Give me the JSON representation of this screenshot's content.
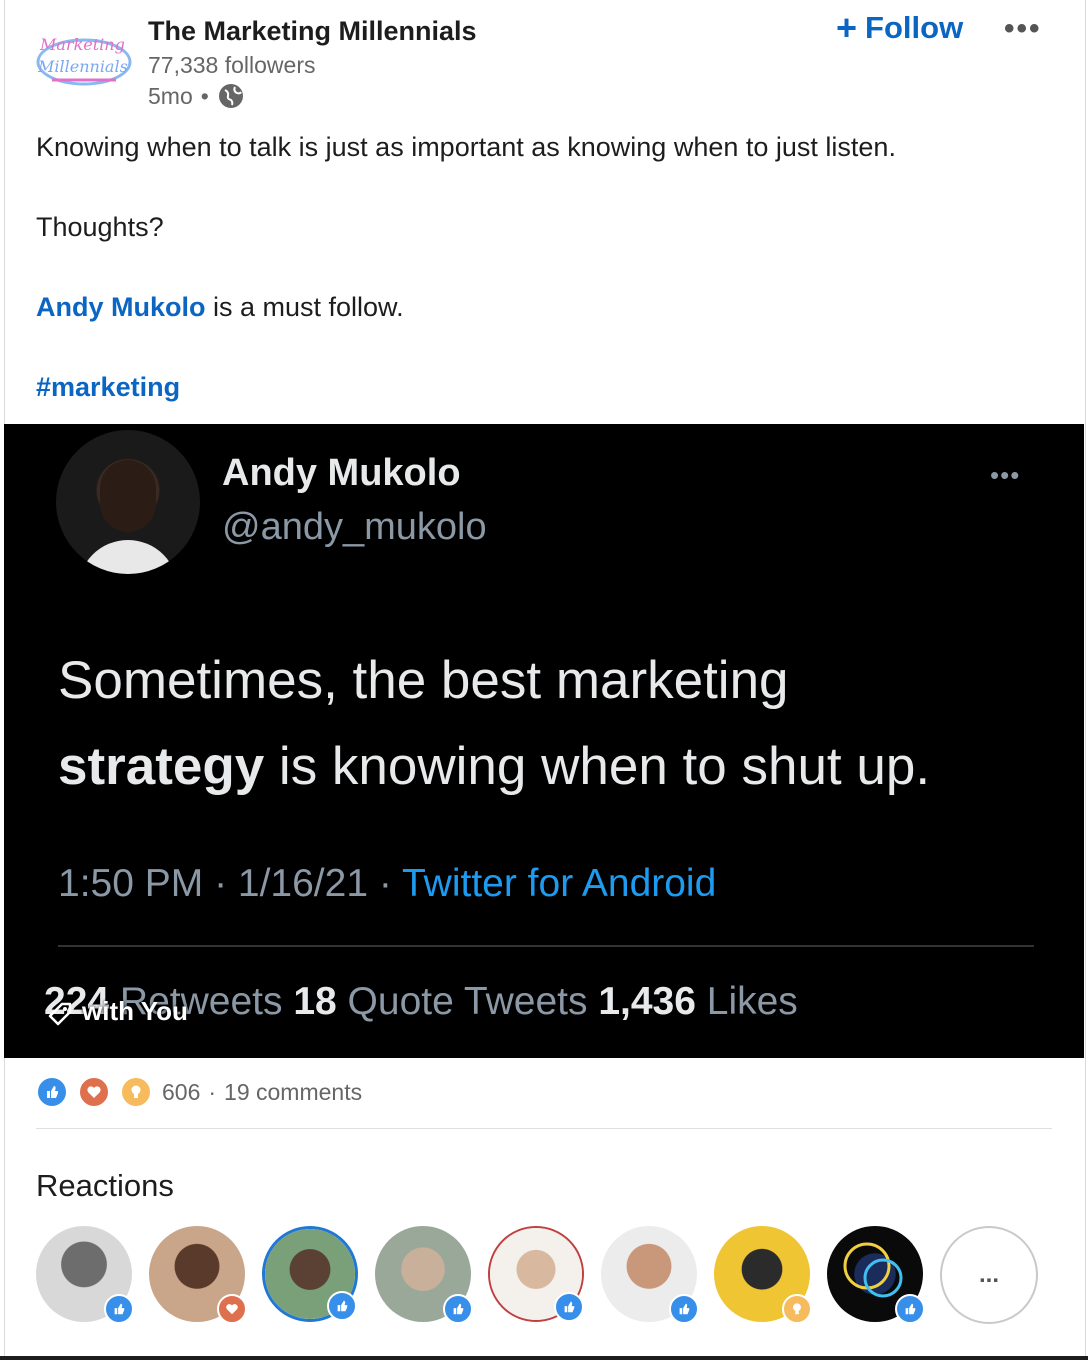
{
  "org": {
    "logo_text": "The Marketing Millennials",
    "name": "The Marketing Millennials",
    "followers": "77,338 followers",
    "age": "5mo",
    "separator": "•",
    "follow_label": "Follow",
    "more_label": "•••"
  },
  "post": {
    "line1": "Knowing when to talk is just as important as knowing when to just listen.",
    "line2": "Thoughts?",
    "mention": "Andy Mukolo",
    "mention_suffix": " is a must follow.",
    "hashtag": "#marketing"
  },
  "tweet": {
    "name": "Andy Mukolo",
    "handle": "@andy_mukolo",
    "more": "•••",
    "body_part1": "Sometimes, the best marketing",
    "body_bold": "strategy",
    "body_part2": " is knowing when to shut up.",
    "time": "1:50 PM · 1/16/21 · ",
    "source": "Twitter for Android",
    "retweets_count": "224",
    "retweets_label": " Retweets  ",
    "quotes_count": "18",
    "quotes_label": " Quote Tweets  ",
    "likes_count": "1,436",
    "likes_label": " Likes",
    "tag_label": "with You"
  },
  "social": {
    "reaction_count": "606",
    "dot": "·",
    "comments": "19 comments"
  },
  "reactions": {
    "title": "Reactions",
    "more": "...",
    "people": [
      {
        "badge": "like"
      },
      {
        "badge": "love"
      },
      {
        "badge": "like"
      },
      {
        "badge": "like"
      },
      {
        "badge": "like"
      },
      {
        "badge": "like"
      },
      {
        "badge": "insightful"
      },
      {
        "badge": "like"
      }
    ]
  },
  "colors": {
    "link": "#0a66c2",
    "twitter_blue": "#1d9bf0",
    "like": "#378fe9",
    "love": "#df704d",
    "insightful": "#f5bb5c"
  }
}
